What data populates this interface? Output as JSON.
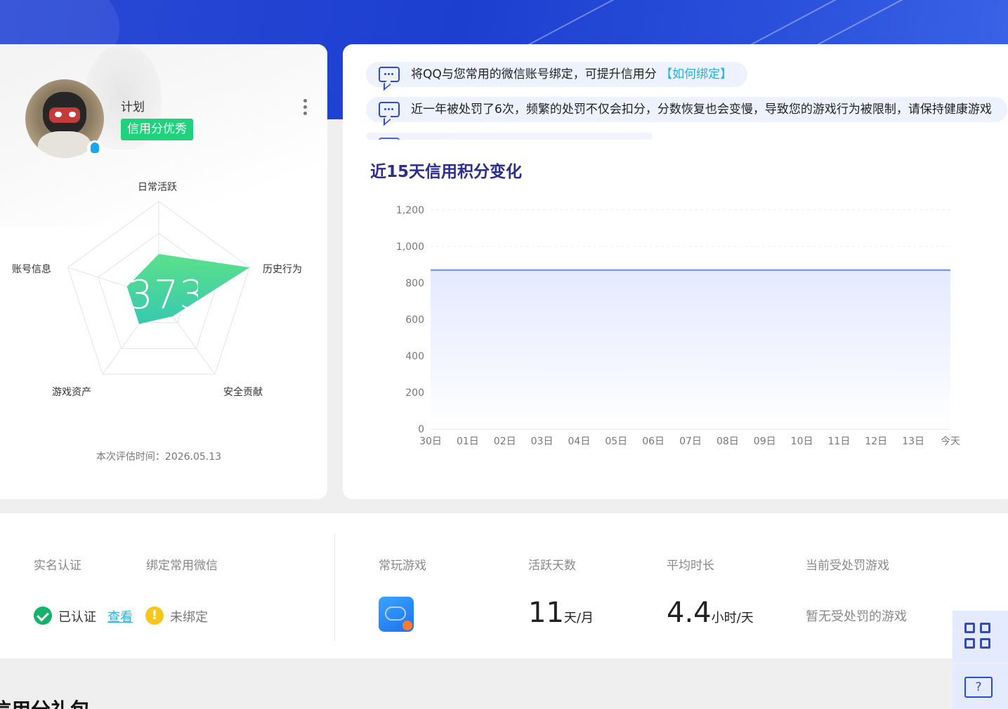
{
  "profile": {
    "nickname": "计划",
    "credit_level": "信用分优秀",
    "score": "373",
    "eval_time": "本次评估时间：2026.05.13",
    "radar": {
      "axes": [
        "日常活跃",
        "历史行为",
        "安全贡献",
        "游戏资产",
        "账号信息"
      ],
      "values": [
        0.45,
        1.0,
        0.25,
        0.35,
        0.35
      ]
    }
  },
  "notices": [
    {
      "text": "将QQ与您常用的微信账号绑定，可提升信用分",
      "link": "【如何绑定】"
    },
    {
      "text": "近一年被处罚了6次，频繁的处罚不仅会扣分，分数恢复也会变慢，导致您的游戏行为被限制，请保持健康游戏",
      "link": ""
    }
  ],
  "chart_title": "近15天信用积分变化",
  "chart_data": {
    "type": "area",
    "title": "近15天信用积分变化",
    "categories": [
      "30日",
      "01日",
      "02日",
      "03日",
      "04日",
      "05日",
      "06日",
      "07日",
      "08日",
      "09日",
      "10日",
      "11日",
      "12日",
      "13日",
      "今天"
    ],
    "series": [
      {
        "values": [
          870,
          870,
          870,
          870,
          870,
          870,
          870,
          870,
          870,
          870,
          870,
          870,
          870,
          870,
          870
        ]
      }
    ],
    "ylim": [
      0,
      1200
    ],
    "yticks": [
      0,
      200,
      400,
      600,
      800,
      1000,
      1200
    ],
    "ytick_labels": [
      "0",
      "200",
      "400",
      "600",
      "800",
      "1,000",
      "1,200"
    ],
    "grid": true,
    "line_color": "#7d9cf0",
    "fill_color": "#e4e9ff"
  },
  "info": {
    "real_name_label": "实名认证",
    "wechat_label": "绑定常用微信",
    "verified_text": "已认证",
    "view_link": "查看",
    "warn_symbol": "!",
    "unbound_text": "未绑定",
    "games_label": "常玩游戏",
    "active_days_label": "活跃天数",
    "active_days_value": "11",
    "active_days_unit": "天/月",
    "avg_time_label": "平均时长",
    "avg_time_value": "4.4",
    "avg_time_unit": "小时/天",
    "penalty_label": "当前受处罚游戏",
    "penalty_value": "暂无受处罚的游戏"
  },
  "side": {
    "help_symbol": "?"
  },
  "section_title": "信用分礼包",
  "colors": {
    "brand_blue": "#2d4bd2",
    "success_green": "#1fd37c",
    "link_cyan": "#20b2e0"
  }
}
